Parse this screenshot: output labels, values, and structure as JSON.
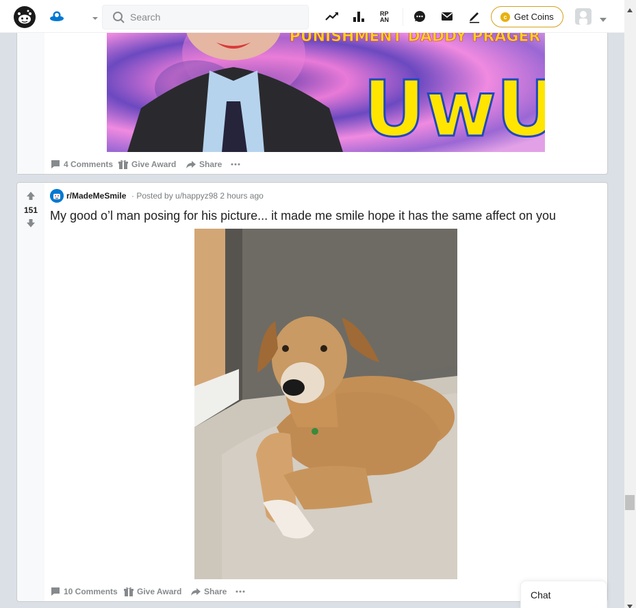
{
  "header": {
    "search_placeholder": "Search",
    "get_coins_label": "Get Coins",
    "coin_symbol": "c",
    "icons": [
      "reddit-logo-icon",
      "home-feed-icon",
      "popular-trending-icon",
      "all-stats-icon",
      "rpan-icon",
      "chat-bubble-icon",
      "mail-icon",
      "create-post-pencil-icon",
      "coin-icon",
      "user-avatar-icon"
    ]
  },
  "post1": {
    "image_text_line1": "PUNISHMENT DADDY PRAGER",
    "image_text_line2": "UwU",
    "comments_label": "4 Comments",
    "award_label": "Give Award",
    "share_label": "Share"
  },
  "post2": {
    "votes": "151",
    "subreddit": "r/MadeMeSmile",
    "posted_by": "· Posted by u/happyz98 2 hours ago",
    "title": "My good o’l man posing for his picture... it made me smile hope it has the same affect on you",
    "comments_label": "10 Comments",
    "award_label": "Give Award",
    "share_label": "Share"
  },
  "chat": {
    "label": "Chat"
  },
  "colors": {
    "accent": "#0079d3",
    "coin_gold": "#e8b20e",
    "page_bg": "#dae0e6",
    "meta_grey": "#787c7e"
  }
}
